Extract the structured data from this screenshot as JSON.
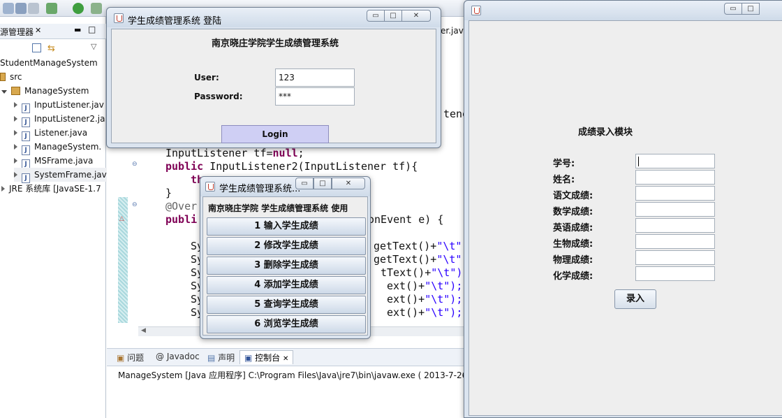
{
  "ide": {
    "explorer_tab": "源管理器",
    "tree": [
      {
        "label": "StudentManageSystem",
        "kind": "project"
      },
      {
        "label": "src",
        "kind": "folder"
      },
      {
        "label": "ManageSystem",
        "kind": "package"
      },
      {
        "label": "InputListener.jav",
        "kind": "java"
      },
      {
        "label": "InputListener2.ja",
        "kind": "java"
      },
      {
        "label": "Listener.java",
        "kind": "java"
      },
      {
        "label": "ManageSystem.",
        "kind": "java"
      },
      {
        "label": "MSFrame.java",
        "kind": "java"
      },
      {
        "label": "SystemFrame.jav",
        "kind": "java"
      },
      {
        "label": "JRE 系统库 [JavaSE-1.7",
        "kind": "lib"
      }
    ],
    "editor_tab_fragment": "er.java",
    "code": {
      "l1": "tene",
      "l2_type": "InputListener",
      "l2_rest": " tf=",
      "l2_null": "null",
      "l2_end": ";",
      "l3_kw": "public",
      "l3_rest": " InputListener2(InputListener tf){",
      "l4": "th",
      "l5": "}",
      "l6": "@Over",
      "l7_kw": "publi",
      "l7_rest": "onEvent e) {",
      "sys_prefix": "Sy",
      "lines": [
        {
          "text": "getText()+",
          "str": "\"\\t\""
        },
        {
          "text": "getText()+",
          "str": "\"\\t\""
        },
        {
          "text": "tText()+",
          "str": "\"\\t\");"
        },
        {
          "text": "ext()+",
          "str": "\"\\t\");"
        },
        {
          "text": "ext()+",
          "str": "\"\\t\");"
        },
        {
          "text": "ext()+",
          "str": "\"\\t\");"
        }
      ]
    },
    "console_tabs": [
      {
        "label": "问题",
        "icon": "problems-icon"
      },
      {
        "label": "@ Javadoc",
        "icon": "javadoc-icon"
      },
      {
        "label": "声明",
        "icon": "declaration-icon"
      },
      {
        "label": "控制台",
        "icon": "console-icon"
      }
    ],
    "console_text": "ManageSystem [Java 应用程序] C:\\Program Files\\Java\\jre7\\bin\\javaw.exe ( 2013-7-26"
  },
  "login_window": {
    "title": "学生成绩管理系统   登陆",
    "heading": "南京晓庄学院学生成绩管理系统",
    "user_label": "User:",
    "user_value": "123",
    "password_label": "Password:",
    "password_value": "***",
    "login_button": "Login"
  },
  "menu_window": {
    "title": "学生成绩管理系统...",
    "header": "南京晓庄学院  学生成绩管理系统  使用",
    "buttons": [
      "1  输入学生成绩",
      "2  修改学生成绩",
      "3  删除学生成绩",
      "4  添加学生成绩",
      "5  查询学生成绩",
      "6  浏览学生成绩"
    ]
  },
  "grade_window": {
    "title": "",
    "module_title": "成绩录入模块",
    "fields": [
      {
        "label": "学号:",
        "value": ""
      },
      {
        "label": "姓名:",
        "value": ""
      },
      {
        "label": "语文成绩:",
        "value": ""
      },
      {
        "label": "数学成绩:",
        "value": ""
      },
      {
        "label": "英语成绩:",
        "value": ""
      },
      {
        "label": "生物成绩:",
        "value": ""
      },
      {
        "label": "物理成绩:",
        "value": ""
      },
      {
        "label": "化学成绩:",
        "value": ""
      }
    ],
    "submit_button": "录入"
  },
  "window_controls": {
    "minimize": "▭",
    "maximize": "□",
    "close": "✕"
  }
}
